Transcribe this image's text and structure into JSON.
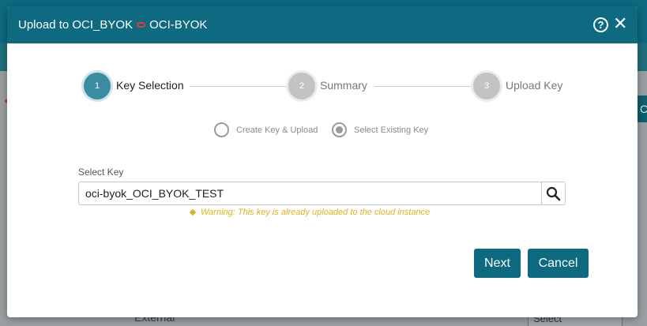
{
  "background": {
    "cell_text": "External",
    "select_text": "Select",
    "side_button_text": "C"
  },
  "modal": {
    "title_prefix": "Upload to OCI_BYOK",
    "title_suffix": "OCI-BYOK",
    "help_glyph": "?",
    "close_glyph": "✕"
  },
  "stepper": {
    "steps": [
      {
        "number": "1",
        "label": "Key Selection",
        "state": "active"
      },
      {
        "number": "2",
        "label": "Summary",
        "state": "inactive"
      },
      {
        "number": "3",
        "label": "Upload Key",
        "state": "inactive"
      }
    ]
  },
  "mode": {
    "options": [
      {
        "label": "Create Key & Upload",
        "selected": false
      },
      {
        "label": "Select Existing Key",
        "selected": true
      }
    ]
  },
  "key": {
    "label": "Select Key",
    "value": "oci-byok_OCI_BYOK_TEST",
    "warning": "Warning: This key is already uploaded to the cloud instance"
  },
  "actions": {
    "next_label": "Next",
    "cancel_label": "Cancel"
  },
  "colors": {
    "primary": "#0e6a80",
    "step_active": "#3a8da0",
    "step_inactive": "#c3c3c3",
    "warning": "#e0b21b",
    "link_icon": "#e23b3b"
  }
}
